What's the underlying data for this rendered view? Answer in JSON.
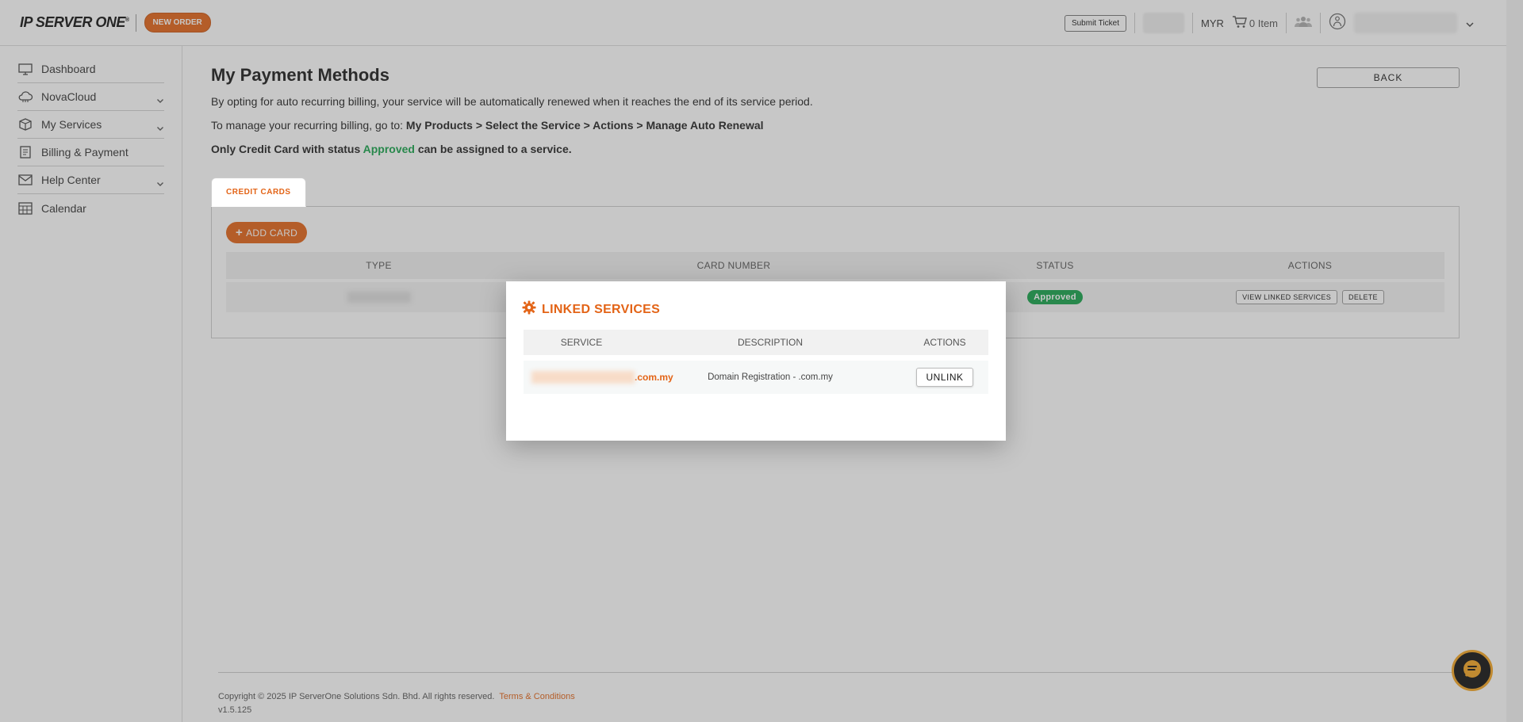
{
  "header": {
    "logo": "IP SERVER ONE",
    "new_order": "NEW ORDER",
    "submit_ticket": "Submit Ticket",
    "currency": "MYR",
    "cart_label": "0 Item"
  },
  "sidebar": {
    "items": [
      {
        "label": "Dashboard",
        "icon": "monitor-icon",
        "has_chevron": false
      },
      {
        "label": "NovaCloud",
        "icon": "cloud-icon",
        "has_chevron": true
      },
      {
        "label": "My Services",
        "icon": "box-icon",
        "has_chevron": true
      },
      {
        "label": "Billing & Payment",
        "icon": "invoice-icon",
        "has_chevron": false
      },
      {
        "label": "Help Center",
        "icon": "mail-icon",
        "has_chevron": true
      },
      {
        "label": "Calendar",
        "icon": "calendar-icon",
        "has_chevron": false
      }
    ]
  },
  "main": {
    "title": "My Payment Methods",
    "back_label": "BACK",
    "desc1": "By opting for auto recurring billing, your service will be automatically renewed when it reaches the end of its service period.",
    "desc2_prefix": "To manage your recurring billing, go to: ",
    "desc2_path": "My Products > Select the Service > Actions > Manage Auto Renewal",
    "desc3_prefix": "Only Credit Card with status ",
    "desc3_status": "Approved",
    "desc3_suffix": " can be assigned to a service.",
    "tab_label": "CREDIT CARDS",
    "add_card_label": "ADD CARD",
    "table": {
      "headers": {
        "type": "TYPE",
        "card_number": "CARD NUMBER",
        "status": "STATUS",
        "actions": "ACTIONS"
      },
      "row": {
        "status": "Approved",
        "view_linked": "VIEW LINKED SERVICES",
        "delete": "DELETE"
      }
    }
  },
  "modal": {
    "title": "LINKED SERVICES",
    "headers": {
      "service": "SERVICE",
      "description": "DESCRIPTION",
      "actions": "ACTIONS"
    },
    "row": {
      "service_suffix": ".com.my",
      "description": "Domain Registration - .com.my",
      "unlink": "UNLINK"
    }
  },
  "footer": {
    "copyright": "Copyright © 2025 IP ServerOne Solutions Sdn. Bhd. All rights reserved.",
    "terms": "Terms & Conditions",
    "version": "v1.5.125"
  },
  "colors": {
    "accent": "#e36417",
    "approved": "#16a34a",
    "chat_ring": "#f5a623"
  }
}
